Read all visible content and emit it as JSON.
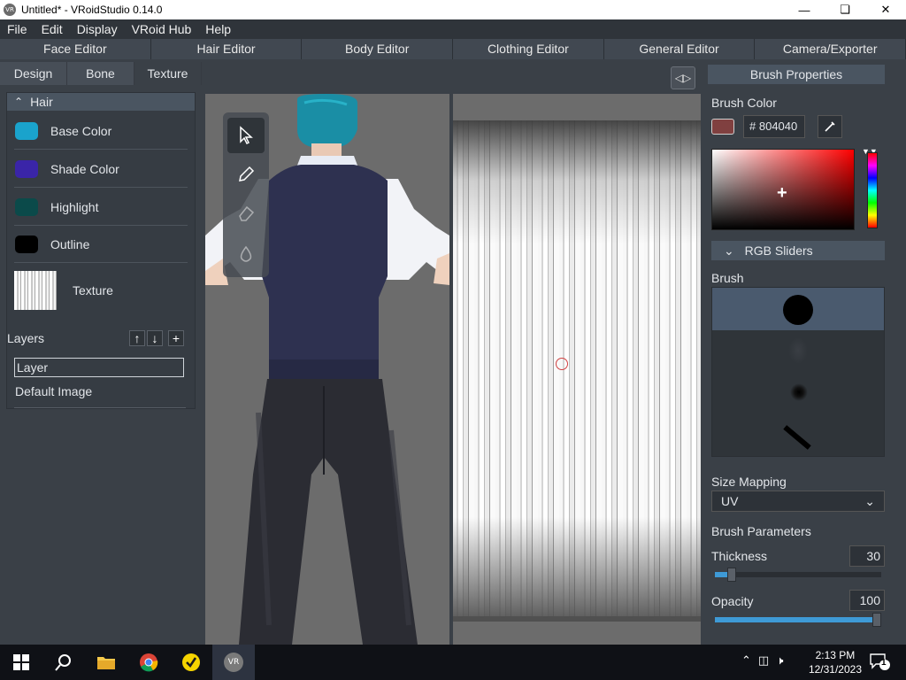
{
  "window": {
    "title": "Untitled* - VRoidStudio 0.14.0",
    "app_icon_text": "VR",
    "controls": [
      "minimize",
      "maximize",
      "close"
    ]
  },
  "menu": [
    "File",
    "Edit",
    "Display",
    "VRoid Hub",
    "Help"
  ],
  "editor_tabs": [
    "Face Editor",
    "Hair Editor",
    "Body Editor",
    "Clothing Editor",
    "General Editor",
    "Camera/Exporter"
  ],
  "left_panel": {
    "tabs": [
      "Design",
      "Bone",
      "Texture"
    ],
    "active_tab": "Texture",
    "section": "Hair",
    "colors": [
      {
        "label": "Base Color",
        "color": "#1aa3cc"
      },
      {
        "label": "Shade Color",
        "color": "#3a25a8"
      },
      {
        "label": "Highlight",
        "color": "#0b4a4a"
      },
      {
        "label": "Outline",
        "color": "#000000"
      }
    ],
    "texture_label": "Texture",
    "layers_label": "Layers",
    "layer_input_value": "Layer",
    "default_image": "Default Image"
  },
  "tools": [
    "select-tool",
    "pen-tool",
    "eraser-tool",
    "fill-tool"
  ],
  "right_panel": {
    "title": "Brush Properties",
    "brush_color_label": "Brush Color",
    "hex_prefix": "#",
    "hex_value": "804040",
    "brush_color": "#804040",
    "rgb_sliders_label": "RGB Sliders",
    "brush_label": "Brush",
    "size_mapping_label": "Size Mapping",
    "size_mapping_value": "UV",
    "brush_params_label": "Brush Parameters",
    "thickness_label": "Thickness",
    "thickness_value": "30",
    "thickness_fraction": 0.1,
    "opacity_label": "Opacity",
    "opacity_value": "100",
    "opacity_fraction": 1.0
  },
  "taskbar": {
    "time": "2:13 PM",
    "date": "12/31/2023",
    "notification_count": "1",
    "active_app_text": "VR"
  }
}
